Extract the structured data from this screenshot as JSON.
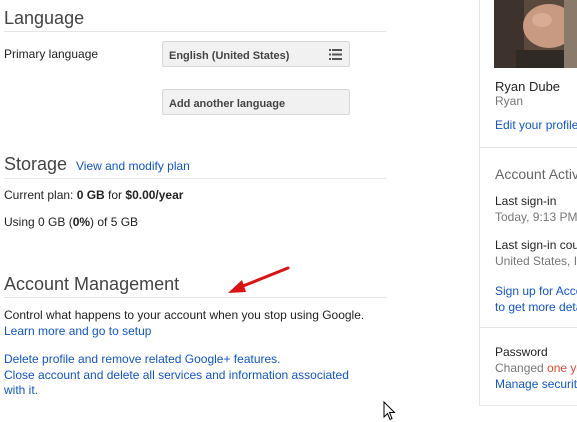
{
  "language": {
    "heading": "Language",
    "primary_label": "Primary language",
    "primary_value": "English (United States)",
    "add_button": "Add another language"
  },
  "storage": {
    "heading": "Storage",
    "view_plan_link": "View and modify plan",
    "current_plan_prefix": "Current plan: ",
    "current_plan_size": "0 GB",
    "current_plan_for": " for ",
    "current_plan_price": "$0.00/year",
    "using_prefix": "Using 0 GB (",
    "using_percent": "0%",
    "using_suffix": ") of 5 GB"
  },
  "account_management": {
    "heading": "Account Management",
    "description": "Control what happens to your account when you stop using Google.",
    "learn_more_link": "Learn more and go to setup",
    "delete_profile_link": "Delete profile and remove related Google+ features.",
    "close_account_link_line1": "Close account and delete all services and information associated",
    "close_account_link_line2": "with it."
  },
  "profile": {
    "name": "Ryan Dube",
    "nickname": "Ryan",
    "edit_link": "Edit your profile"
  },
  "activity": {
    "heading": "Account Activity",
    "last_signin_label": "Last sign-in",
    "last_signin_value": "Today, 9:13 PM",
    "last_signin_country_label": "Last sign-in country",
    "last_signin_country_value": "United States, I",
    "signup_link_line1": "Sign up for Account",
    "signup_link_line2": "to get more details"
  },
  "password": {
    "label": "Password",
    "changed_prefix": "Changed ",
    "changed_highlight": "one year",
    "manage_link": "Manage security"
  },
  "colors": {
    "link": "#1155cc",
    "annotation_arrow": "#dd1111",
    "highlight": "#dd4b39"
  }
}
